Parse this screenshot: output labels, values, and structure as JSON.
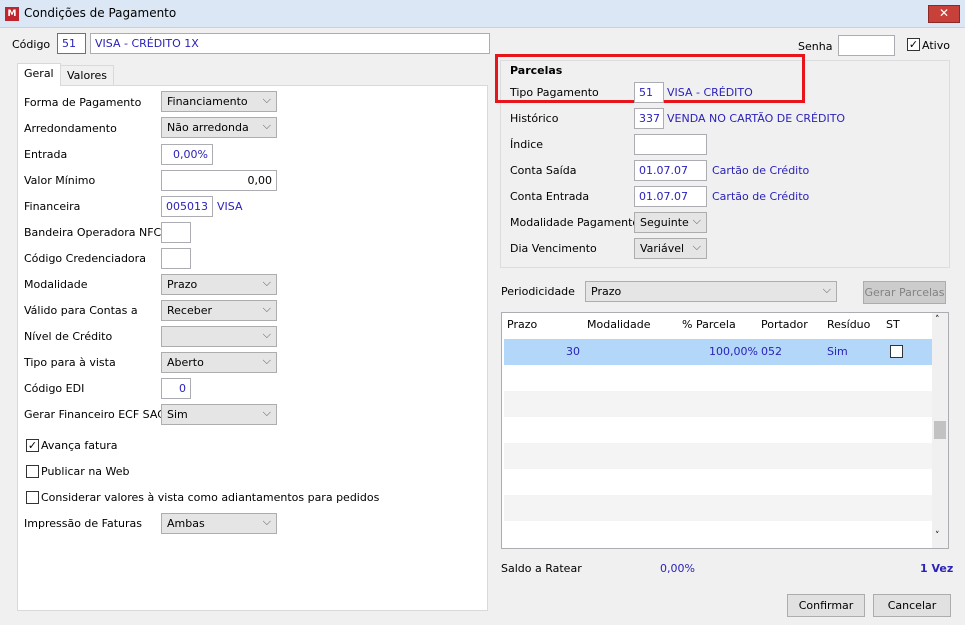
{
  "window": {
    "title": "Condições de Pagamento",
    "close": "✕"
  },
  "header": {
    "codigo_label": "Código",
    "codigo": "51",
    "descricao": "VISA - CRÉDITO 1X",
    "senha_label": "Senha",
    "senha": "",
    "ativo_label": "Ativo",
    "ativo": true
  },
  "tabs": [
    {
      "label": "Geral"
    },
    {
      "label": "Valores"
    }
  ],
  "geral": {
    "forma_label": "Forma de Pagamento",
    "forma": "Financiamento",
    "arred_label": "Arredondamento",
    "arred": "Não arredonda",
    "entrada_label": "Entrada",
    "entrada": "0,00%",
    "valor_min_label": "Valor Mínimo",
    "valor_min": "0,00",
    "financeira_label": "Financeira",
    "financeira_cod": "005013",
    "financeira_nome": "VISA",
    "bandeira_label": "Bandeira Operadora NFC-e",
    "bandeira": "",
    "credenciadora_label": "Código Credenciadora",
    "credenciadora": "",
    "modalidade_label": "Modalidade",
    "modalidade": "Prazo",
    "valido_label": "Válido para Contas a",
    "valido": "Receber",
    "nivel_label": "Nível de Crédito",
    "nivel": "",
    "tipo_vista_label": "Tipo para à vista",
    "tipo_vista": "Aberto",
    "edi_label": "Código EDI",
    "edi": "0",
    "ecf_label": "Gerar Financeiro ECF SAC",
    "ecf": "Sim",
    "avanca_label": "Avança fatura",
    "avanca": true,
    "publicar_label": "Publicar na Web",
    "publicar": false,
    "considerar_label": "Considerar valores à vista como adiantamentos para pedidos",
    "considerar": false,
    "impressao_label": "Impressão de Faturas",
    "impressao": "Ambas"
  },
  "parcelas": {
    "title": "Parcelas",
    "tipo_label": "Tipo Pagamento",
    "tipo_cod": "51",
    "tipo_nome": "VISA - CRÉDITO",
    "historico_label": "Histórico",
    "historico_cod": "337",
    "historico_nome": "VENDA NO CARTÃO DE CRÉDITO",
    "indice_label": "Índice",
    "indice": "",
    "saida_label": "Conta Saída",
    "saida_cod": "01.07.07",
    "saida_nome": "Cartão de Crédito",
    "entrada_label": "Conta Entrada",
    "entrada_cod": "01.07.07",
    "entrada_nome": "Cartão de Crédito",
    "modalidade_label": "Modalidade Pagamento",
    "modalidade": "Seguinte",
    "dia_label": "Dia Vencimento",
    "dia": "Variável",
    "highlight_color": "#e8141b"
  },
  "periodicidade": {
    "label": "Periodicidade",
    "value": "Prazo",
    "gerar": "Gerar Parcelas"
  },
  "table": {
    "columns": [
      "Prazo",
      "Modalidade",
      "% Parcela",
      "Portador",
      "Resíduo",
      "ST"
    ],
    "rows": [
      {
        "prazo": "30",
        "modalidade": "",
        "parcela": "100,00%",
        "portador": "052",
        "residuo": "Sim",
        "st": false
      }
    ]
  },
  "footer": {
    "saldo_label": "Saldo a Ratear",
    "saldo": "0,00%",
    "vezes": "1 Vez",
    "confirmar": "Confirmar",
    "cancelar": "Cancelar"
  }
}
